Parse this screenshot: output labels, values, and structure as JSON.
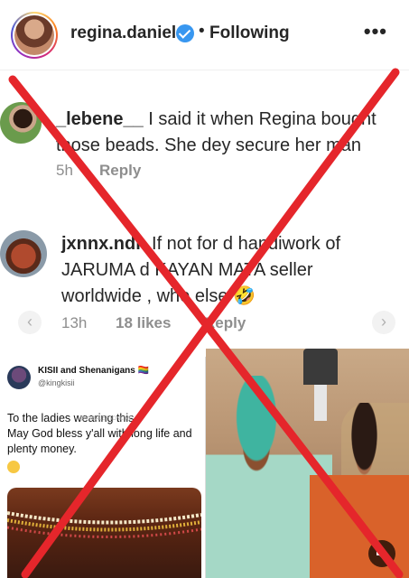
{
  "header": {
    "username": "regina.daniels",
    "separator": "•",
    "follow_status": "Following",
    "more_label": "•••"
  },
  "comments": [
    {
      "username": "_lebene__",
      "text": " I said it when Regina bought those beads. She dey secure her man",
      "time": "5h",
      "reply_label": "Reply"
    },
    {
      "username": "jxnnx.ndn",
      "text": " If not for d handiwork of JARUMA d KAYAN MATA seller worldwide , who else 🤣",
      "time": "13h",
      "likes": "18 likes",
      "reply_label": "Reply"
    }
  ],
  "carousel": {
    "prev_icon": "‹",
    "next_icon": "›"
  },
  "tweet": {
    "name": "KISII and Shenanigans 🏳️‍🌈",
    "handle": "@kingkisii",
    "body": "To the ladies wearing this.\nMay God bless y'all with long life and plenty money.",
    "watermark": "@YABALEFTONLINE"
  },
  "colors": {
    "x_mark": "#e5262b",
    "verified": "#3897f0",
    "meta_gray": "#8e8e8e"
  },
  "icons": {
    "verified": "verified-badge-icon",
    "more": "more-options-icon",
    "sound": "speaker-icon"
  }
}
